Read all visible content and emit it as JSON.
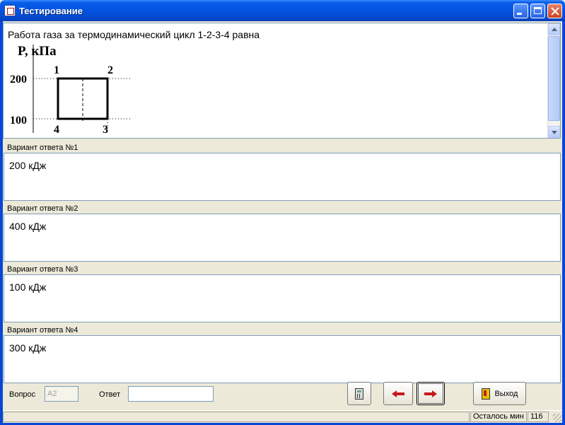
{
  "window": {
    "title": "Тестирование"
  },
  "question": {
    "text": "Работа газа за термодинамический цикл 1-2-3-4 равна",
    "diagram": {
      "y_axis_label": "P, кПа",
      "y_ticks": [
        "200",
        "100"
      ],
      "point_labels": [
        "1",
        "2",
        "3",
        "4"
      ]
    }
  },
  "answers": [
    {
      "label": "Вариант ответа №1",
      "text": "200 кДж"
    },
    {
      "label": "Вариант ответа №2",
      "text": "400 кДж"
    },
    {
      "label": "Вариант ответа №3",
      "text": "100 кДж"
    },
    {
      "label": "Вариант ответа №4",
      "text": "300 кДж"
    }
  ],
  "footer": {
    "question_label": "Вопрос",
    "question_value": "A2",
    "answer_label": "Ответ",
    "answer_value": "",
    "exit_label": "Выход"
  },
  "status": {
    "remaining_label": "Осталось мин",
    "remaining_value": "116"
  },
  "icons": {
    "calculator": "calculator-icon",
    "prev": "arrow-left-icon",
    "next": "arrow-right-icon",
    "exit": "exit-door-icon"
  }
}
